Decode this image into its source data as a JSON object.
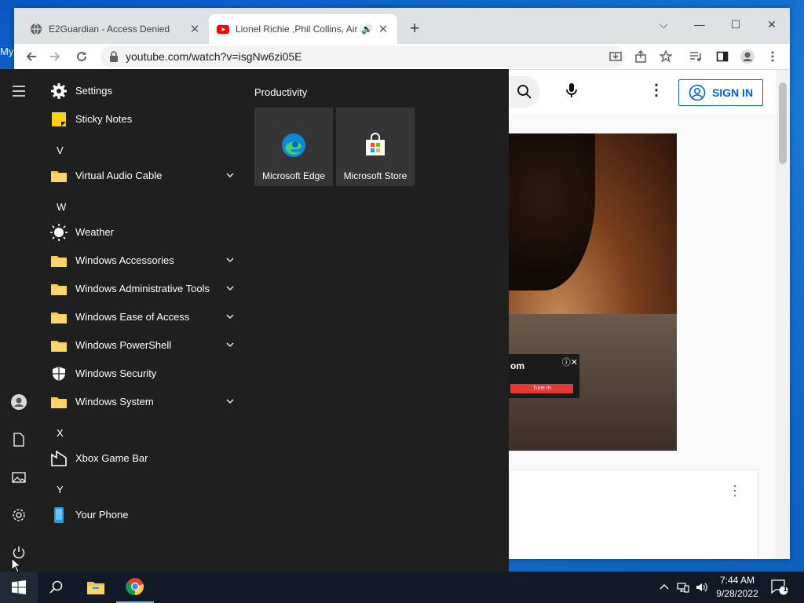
{
  "desktop": {
    "label": "My"
  },
  "browser": {
    "tabs": [
      {
        "title": "E2Guardian - Access Denied",
        "close": "✕"
      },
      {
        "title": "Lionel Richie ,Phil Collins, Air Supply",
        "close": "✕",
        "speaker": "🔊"
      }
    ],
    "new_tab": "+",
    "window_controls": {
      "dropdown": "⌵",
      "minimize": "—",
      "maximize": "☐",
      "close": "✕"
    },
    "url": "youtube.com/watch?v=isgNw6zi05E"
  },
  "youtube": {
    "sign_in": "SIGN IN",
    "more": "⋮",
    "ad": {
      "text": "om",
      "button": "Tune In",
      "controls": "ⓘ✕"
    },
    "card_more": "⋮"
  },
  "start_menu": {
    "apps": [
      {
        "label": "Settings",
        "icon": "gear-icon"
      },
      {
        "label": "Sticky Notes",
        "icon": "sticky-notes-icon"
      },
      {
        "letter": "V"
      },
      {
        "label": "Virtual Audio Cable",
        "icon": "folder-icon",
        "expandable": true
      },
      {
        "letter": "W"
      },
      {
        "label": "Weather",
        "icon": "weather-icon"
      },
      {
        "label": "Windows Accessories",
        "icon": "folder-icon",
        "expandable": true
      },
      {
        "label": "Windows Administrative Tools",
        "icon": "folder-icon",
        "expandable": true
      },
      {
        "label": "Windows Ease of Access",
        "icon": "folder-icon",
        "expandable": true
      },
      {
        "label": "Windows PowerShell",
        "icon": "folder-icon",
        "expandable": true
      },
      {
        "label": "Windows Security",
        "icon": "shield-icon"
      },
      {
        "label": "Windows System",
        "icon": "folder-icon",
        "expandable": true
      },
      {
        "letter": "X"
      },
      {
        "label": "Xbox Game Bar",
        "icon": "xbox-icon"
      },
      {
        "letter": "Y"
      },
      {
        "label": "Your Phone",
        "icon": "phone-icon"
      }
    ],
    "tile_group": "Productivity",
    "tiles": [
      {
        "label": "Microsoft Edge",
        "icon": "edge-icon"
      },
      {
        "label": "Microsoft Store",
        "icon": "store-icon"
      }
    ]
  },
  "taskbar": {
    "time": "7:44 AM",
    "date": "9/28/2022",
    "notification_count": "1"
  }
}
